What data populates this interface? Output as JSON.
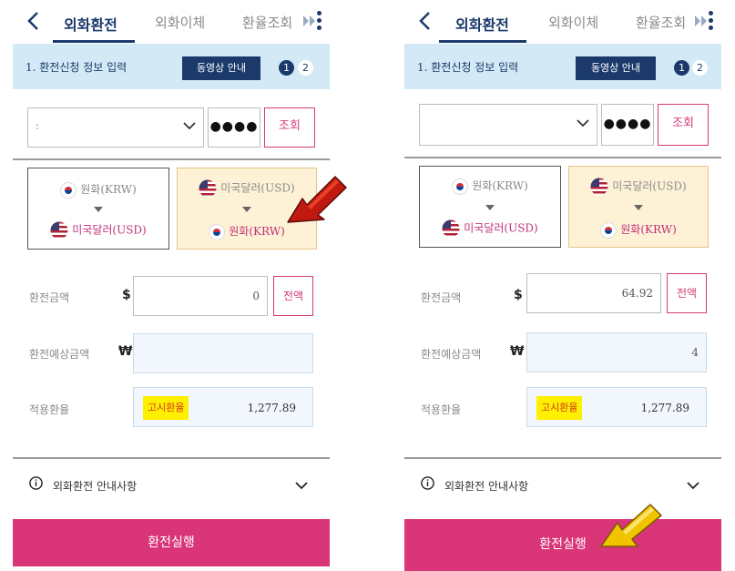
{
  "colors": {
    "navy": "#1b3a6b",
    "pink": "#d93578",
    "accent_pink": "#d43b78",
    "highlight": "#ffef00",
    "step_bg": "#d3e9f5"
  },
  "screens": [
    {
      "tabs": [
        "외화환전",
        "외화이체",
        "환율조회"
      ],
      "step_label": "1. 환전신청 정보 입력",
      "video_button": "동영상 안내",
      "steps": [
        "1",
        "2"
      ],
      "account_value": ":",
      "password_mask": "●●●●",
      "lookup_button": "조회",
      "from_option": {
        "top": "원화(KRW)",
        "bottom": "미국달러(USD)"
      },
      "to_option": {
        "top": "미국달러(USD)",
        "bottom": "원화(KRW)"
      },
      "amount_label": "환전금액",
      "amount_symbol": "$",
      "amount_value": "0",
      "all_button": "전액",
      "expected_label": "환전예상금액",
      "expected_symbol": "₩",
      "expected_value": "",
      "rate_label": "적용환율",
      "rate_badge": "고시환율",
      "rate_value": "1,277.89",
      "guide": "외화환전 안내사항",
      "execute": "환전실행",
      "callout": "red-arrow-icon"
    },
    {
      "tabs": [
        "외화환전",
        "외화이체",
        "환율조회"
      ],
      "step_label": "1. 환전신청 정보 입력",
      "video_button": "동영상 안내",
      "steps": [
        "1",
        "2"
      ],
      "account_value": "",
      "password_mask": "●●●●",
      "lookup_button": "조회",
      "from_option": {
        "top": "원화(KRW)",
        "bottom": "미국달러(USD)"
      },
      "to_option": {
        "top": "미국달러(USD)",
        "bottom": "원화(KRW)"
      },
      "amount_label": "환전금액",
      "amount_symbol": "$",
      "amount_value": "64.92",
      "all_button": "전액",
      "expected_label": "환전예상금액",
      "expected_symbol": "₩",
      "expected_value": "4",
      "rate_label": "적용환율",
      "rate_badge": "고시환율",
      "rate_value": "1,277.89",
      "guide": "외화환전 안내사항",
      "execute": "환전실행",
      "callout": "yellow-arrow-icon"
    }
  ]
}
